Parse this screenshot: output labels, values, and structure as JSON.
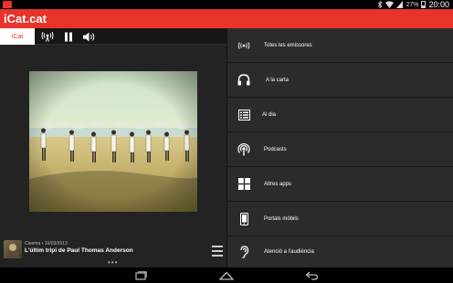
{
  "status_bar": {
    "battery": "27%",
    "time": "20:00"
  },
  "app": {
    "logo": "iCat.cat",
    "accent": "#e8332a"
  },
  "player": {
    "station_tab": "iCat",
    "now_playing": {
      "meta": "Cinema • 19/03/2013",
      "title": "L'últim tripi de Paul Thomas Anderson"
    }
  },
  "menu": {
    "items": [
      {
        "label": "Totes les emissores",
        "icon": "broadcast-icon"
      },
      {
        "label": "A la carta",
        "icon": "headphones-icon"
      },
      {
        "label": "Al dia",
        "icon": "news-icon"
      },
      {
        "label": "Podcasts",
        "icon": "podcast-icon"
      },
      {
        "label": "Altres apps",
        "icon": "apps-grid-icon"
      },
      {
        "label": "Portals mòbils",
        "icon": "phone-icon"
      },
      {
        "label": "Atenció a l'audiència",
        "icon": "ear-icon"
      }
    ]
  }
}
